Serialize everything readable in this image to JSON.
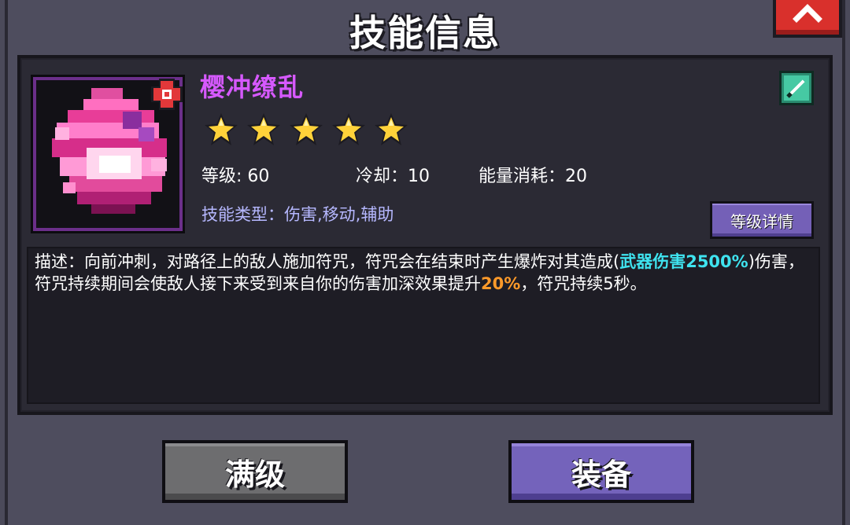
{
  "dialog": {
    "title": "技能信息"
  },
  "skill": {
    "name": "樱冲缭乱",
    "stars": 5,
    "level_label": "等级: 60",
    "cooldown_label": "冷却：10",
    "energy_label": "能量消耗：20",
    "types_label": "技能类型：伤害,移动,辅助",
    "detail_button": "等级详情"
  },
  "description": {
    "part1": "描述：向前冲刺，对路径上的敌人施加符咒，符咒会在结束时产生爆炸对其造成(",
    "highlight1": "武器伤害2500%",
    "part2": ")伤害，符咒持续期间会使敌人接下来受到来自你的伤害加深效果提升",
    "highlight2": "20%",
    "part3": "，符咒持续5秒。"
  },
  "buttons": {
    "max_level": "满级",
    "equip": "装备"
  },
  "colors": {
    "skill_name": "#d659ff",
    "types_text": "#b6b8ff",
    "highlight_cyan": "#3fe3ef",
    "highlight_orange": "#ff9a2a",
    "button_primary": "#7463bb",
    "button_secondary": "#6d6d6f",
    "close_button": "#d9302c"
  },
  "icons": {
    "close": "close-x-icon",
    "skill": "sakura-dash-skill-icon",
    "badge": "red-rank-badge-icon",
    "weapon": "sword-weapon-icon",
    "star": "gold-star-icon"
  }
}
